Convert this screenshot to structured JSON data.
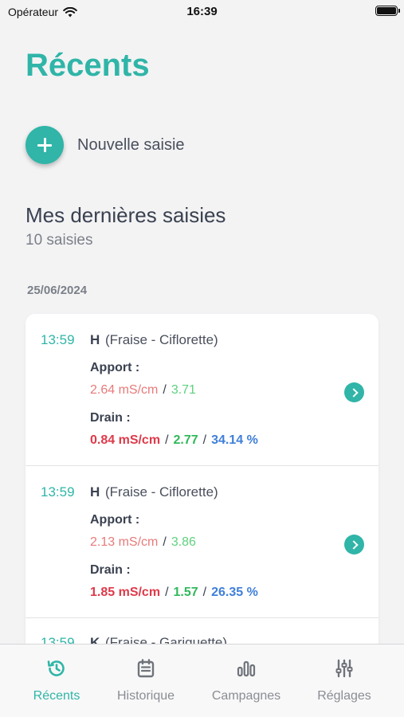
{
  "status_bar": {
    "carrier": "Opérateur",
    "time": "16:39"
  },
  "page_title": "Récents",
  "new_entry": {
    "label": "Nouvelle saisie",
    "icon": "plus-icon"
  },
  "section": {
    "title": "Mes dernières saisies",
    "count": "10 saisies"
  },
  "date_group": "25/06/2024",
  "entries": [
    {
      "time": "13:59",
      "code": "H",
      "crop": "(Fraise - Ciflorette)",
      "apport_label": "Apport :",
      "apport_ec": "2.64 mS/cm",
      "apport_ph": "3.71",
      "drain_label": "Drain :",
      "drain_ec": "0.84 mS/cm",
      "drain_ph": "2.77",
      "drain_pct": "34.14 %"
    },
    {
      "time": "13:59",
      "code": "H",
      "crop": "(Fraise - Ciflorette)",
      "apport_label": "Apport :",
      "apport_ec": "2.13 mS/cm",
      "apport_ph": "3.86",
      "drain_label": "Drain :",
      "drain_ec": "1.85 mS/cm",
      "drain_ph": "1.57",
      "drain_pct": "26.35 %"
    },
    {
      "time": "13:59",
      "code": "K",
      "crop": "(Fraise - Gariguette)"
    }
  ],
  "separator": "/",
  "tabs": [
    {
      "label": "Récents",
      "icon": "history-icon",
      "active": true
    },
    {
      "label": "Historique",
      "icon": "calendar-icon",
      "active": false
    },
    {
      "label": "Campagnes",
      "icon": "bar-chart-icon",
      "active": false
    },
    {
      "label": "Réglages",
      "icon": "sliders-icon",
      "active": false
    }
  ],
  "colors": {
    "accent": "#30b5a8",
    "ec_light": "#e87a7a",
    "ph_light": "#5fd17e",
    "ec_strong": "#de3a4a",
    "ph_strong": "#31b85a",
    "percent": "#3f7fd9"
  }
}
